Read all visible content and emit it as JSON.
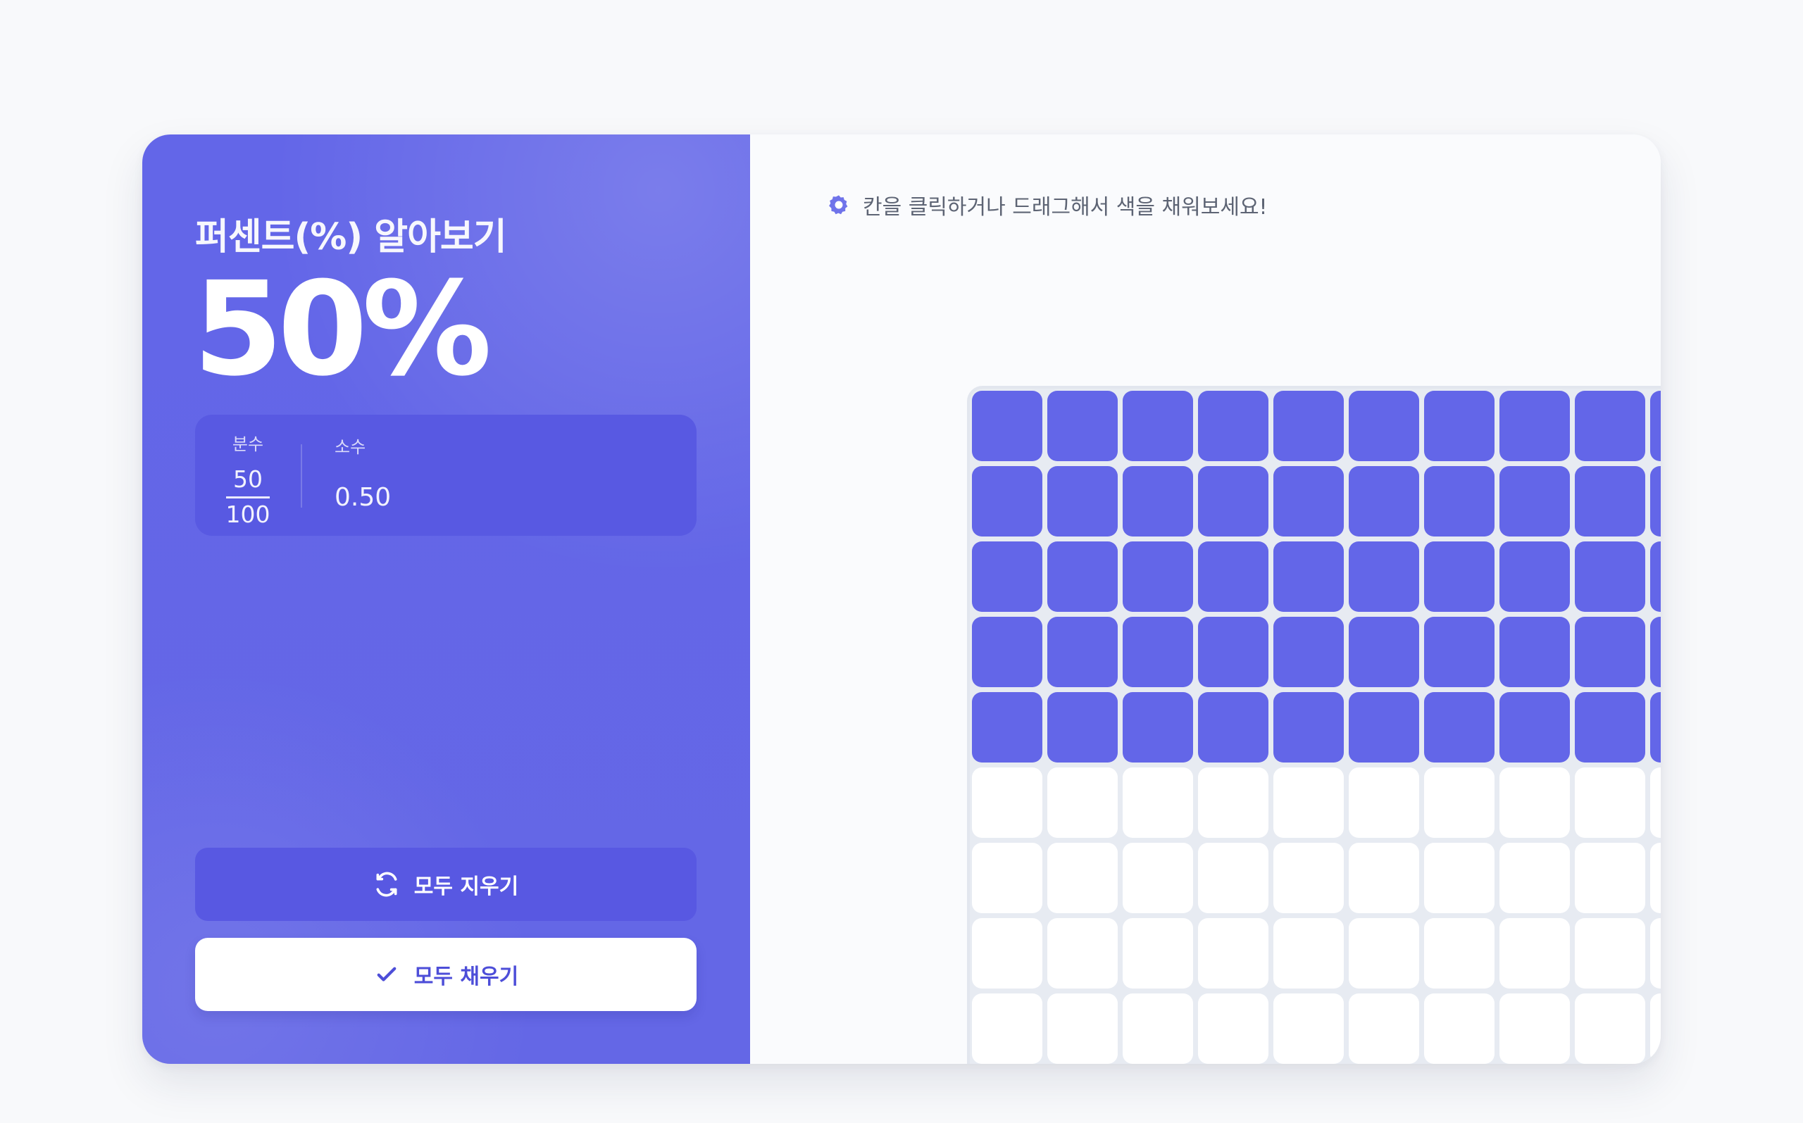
{
  "app": {
    "title": "퍼센트(%) 알아보기"
  },
  "summary": {
    "percent": "50%",
    "fraction_label": "분수",
    "fraction_numerator": "50",
    "fraction_denominator": "100",
    "decimal_label": "소수",
    "decimal_value": "0.50"
  },
  "actions": {
    "clear_label": "모두 지우기",
    "fill_label": "모두 채우기",
    "clear_icon": "refresh-icon",
    "fill_icon": "check-icon"
  },
  "instructions": {
    "text": "칸을 클릭하거나 드래그해서 색을 채워보세요!",
    "icon": "gear-icon"
  },
  "grid": {
    "rows": 10,
    "columns": 10,
    "filled_cells": 50,
    "filled_rows": 5
  },
  "colors": {
    "accent": "#6366e8",
    "accent_dark": "#5858e2",
    "background": "#f8f9fb",
    "grid_border": "#e2e6ee",
    "cell_empty": "#ffffff"
  }
}
